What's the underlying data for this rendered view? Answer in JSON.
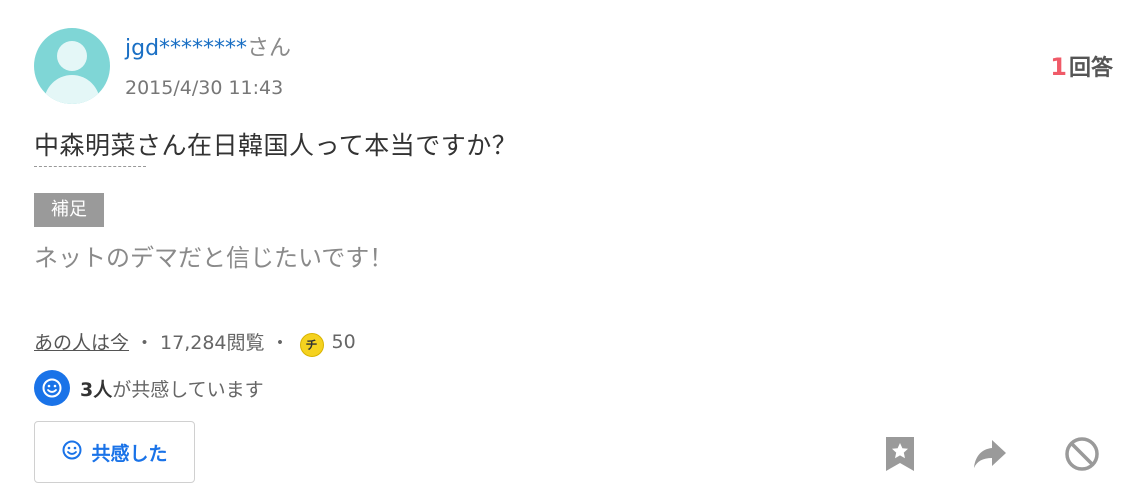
{
  "user": {
    "name": "jgd********",
    "suffix": "さん",
    "date": "2015/4/30 11:43"
  },
  "answers": {
    "count": "1",
    "label": "回答"
  },
  "question": {
    "text": "中森明菜さん在日韓国人って本当ですか？"
  },
  "supplement": {
    "badge": "補足",
    "text": "ネットのデマだと信じたいです！"
  },
  "meta": {
    "category": "あの人は今",
    "sep1": "・",
    "views": "17,284閲覧",
    "sep2": "・",
    "coin_icon": "チ",
    "coins": "50"
  },
  "empathy": {
    "count": "3人",
    "text": "が共感しています",
    "button_label": "共感した"
  },
  "actions": {
    "bookmark_icon": "bookmark-star-icon",
    "share_icon": "share-arrow-icon",
    "block_icon": "block-icon"
  },
  "colors": {
    "link": "#1a6fc4",
    "accent": "#1a73e8",
    "answer_count": "#f05a68",
    "icon_gray": "#9a9a9a"
  }
}
